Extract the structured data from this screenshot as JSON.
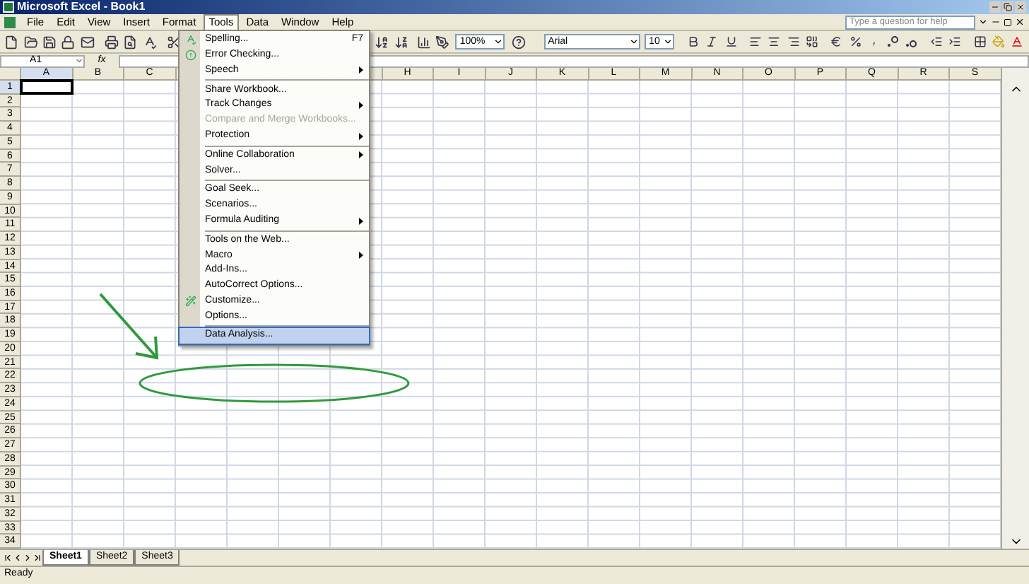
{
  "window": {
    "title": "Microsoft Excel - Book1"
  },
  "menu_bar": [
    {
      "label": "File",
      "selected": false
    },
    {
      "label": "Edit",
      "selected": false
    },
    {
      "label": "View",
      "selected": false
    },
    {
      "label": "Insert",
      "selected": false
    },
    {
      "label": "Format",
      "selected": false
    },
    {
      "label": "Tools",
      "selected": true
    },
    {
      "label": "Data",
      "selected": false
    },
    {
      "label": "Window",
      "selected": false
    },
    {
      "label": "Help",
      "selected": false
    }
  ],
  "help_box": {
    "placeholder": "Type a question for help"
  },
  "toolbar": {
    "zoom": "100%",
    "font": "Arial",
    "font_size": "10"
  },
  "formula_bar": {
    "name_box": "A1",
    "function_button": "fx"
  },
  "columns": {
    "left": [
      {
        "label": "A",
        "selected": true
      },
      {
        "label": "B",
        "selected": false
      },
      {
        "label": "C",
        "selected": false
      }
    ],
    "right": [
      {
        "label": "H",
        "selected": false
      },
      {
        "label": "I",
        "selected": false
      },
      {
        "label": "J",
        "selected": false
      },
      {
        "label": "K",
        "selected": false
      },
      {
        "label": "L",
        "selected": false
      },
      {
        "label": "M",
        "selected": false
      },
      {
        "label": "N",
        "selected": false
      },
      {
        "label": "O",
        "selected": false
      },
      {
        "label": "P",
        "selected": false
      },
      {
        "label": "Q",
        "selected": false
      },
      {
        "label": "R",
        "selected": false
      },
      {
        "label": "S",
        "selected": false
      }
    ]
  },
  "rows": [
    {
      "label": "1",
      "selected": true
    },
    {
      "label": "2",
      "selected": false
    },
    {
      "label": "3",
      "selected": false
    },
    {
      "label": "4",
      "selected": false
    },
    {
      "label": "5",
      "selected": false
    },
    {
      "label": "6",
      "selected": false
    },
    {
      "label": "7",
      "selected": false
    },
    {
      "label": "8",
      "selected": false
    },
    {
      "label": "9",
      "selected": false
    },
    {
      "label": "10",
      "selected": false
    },
    {
      "label": "11",
      "selected": false
    },
    {
      "label": "12",
      "selected": false
    },
    {
      "label": "13",
      "selected": false
    },
    {
      "label": "14",
      "selected": false
    },
    {
      "label": "15",
      "selected": false
    },
    {
      "label": "16",
      "selected": false
    },
    {
      "label": "17",
      "selected": false
    },
    {
      "label": "18",
      "selected": false
    },
    {
      "label": "19",
      "selected": false
    },
    {
      "label": "20",
      "selected": false
    },
    {
      "label": "21",
      "selected": false
    },
    {
      "label": "22",
      "selected": false
    },
    {
      "label": "23",
      "selected": false
    },
    {
      "label": "24",
      "selected": false
    },
    {
      "label": "25",
      "selected": false
    },
    {
      "label": "26",
      "selected": false
    },
    {
      "label": "27",
      "selected": false
    },
    {
      "label": "28",
      "selected": false
    },
    {
      "label": "29",
      "selected": false
    },
    {
      "label": "30",
      "selected": false
    },
    {
      "label": "31",
      "selected": false
    },
    {
      "label": "32",
      "selected": false
    },
    {
      "label": "33",
      "selected": false
    },
    {
      "label": "34",
      "selected": false
    }
  ],
  "tools_menu": {
    "items": [
      {
        "kind": "item",
        "label": "Spelling...",
        "shortcut": "F7",
        "submenu": false,
        "disabled": false,
        "selected": false
      },
      {
        "kind": "item",
        "label": "Error Checking...",
        "submenu": false,
        "disabled": false,
        "selected": false
      },
      {
        "kind": "item",
        "label": "Speech",
        "submenu": true,
        "disabled": false,
        "selected": false
      },
      {
        "kind": "separator"
      },
      {
        "kind": "item",
        "label": "Share Workbook...",
        "submenu": false,
        "disabled": false,
        "selected": false
      },
      {
        "kind": "item",
        "label": "Track Changes",
        "submenu": true,
        "disabled": false,
        "selected": false
      },
      {
        "kind": "item",
        "label": "Compare and Merge Workbooks...",
        "submenu": false,
        "disabled": true,
        "selected": false
      },
      {
        "kind": "item",
        "label": "Protection",
        "submenu": true,
        "disabled": false,
        "selected": false
      },
      {
        "kind": "separator"
      },
      {
        "kind": "item",
        "label": "Online Collaboration",
        "submenu": true,
        "disabled": false,
        "selected": false
      },
      {
        "kind": "item",
        "label": "Solver...",
        "submenu": false,
        "disabled": false,
        "selected": false
      },
      {
        "kind": "separator"
      },
      {
        "kind": "item",
        "label": "Goal Seek...",
        "submenu": false,
        "disabled": false,
        "selected": false
      },
      {
        "kind": "item",
        "label": "Scenarios...",
        "submenu": false,
        "disabled": false,
        "selected": false
      },
      {
        "kind": "item",
        "label": "Formula Auditing",
        "submenu": true,
        "disabled": false,
        "selected": false
      },
      {
        "kind": "separator"
      },
      {
        "kind": "item",
        "label": "Tools on the Web...",
        "submenu": false,
        "disabled": false,
        "selected": false
      },
      {
        "kind": "item",
        "label": "Macro",
        "submenu": true,
        "disabled": false,
        "selected": false
      },
      {
        "kind": "item",
        "label": "Add-Ins...",
        "submenu": false,
        "disabled": false,
        "selected": false
      },
      {
        "kind": "item",
        "label": "AutoCorrect Options...",
        "submenu": false,
        "disabled": false,
        "selected": false
      },
      {
        "kind": "item",
        "label": "Customize...",
        "submenu": false,
        "disabled": false,
        "selected": false
      },
      {
        "kind": "item",
        "label": "Options...",
        "submenu": false,
        "disabled": false,
        "selected": false
      },
      {
        "kind": "separator"
      },
      {
        "kind": "item",
        "label": "Data Analysis...",
        "submenu": false,
        "disabled": false,
        "selected": true
      }
    ]
  },
  "sheet_tabs": [
    {
      "label": "Sheet1",
      "selected": true
    },
    {
      "label": "Sheet2",
      "selected": false
    },
    {
      "label": "Sheet3",
      "selected": false
    }
  ],
  "status_bar": "Ready"
}
